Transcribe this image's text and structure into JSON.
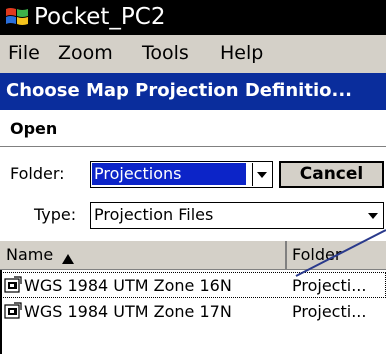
{
  "window": {
    "title": "Pocket_PC2"
  },
  "menu": [
    "File",
    "Zoom",
    "Tools",
    "Help"
  ],
  "dialog": {
    "title": "Choose Map Projection Definitio...",
    "open_label": "Open",
    "folder_label": "Folder:",
    "folder_value": "Projections",
    "cancel_label": "Cancel",
    "type_label": "Type:",
    "type_value": "Projection Files"
  },
  "list": {
    "columns": [
      "Name",
      "Folder"
    ],
    "rows": [
      {
        "name": "WGS 1984 UTM Zone 16N",
        "folder": "Projecti..."
      },
      {
        "name": "WGS 1984 UTM Zone 17N",
        "folder": "Projecti..."
      }
    ]
  },
  "colors": {
    "title_bg": "#000000",
    "dialog_header_bg": "#0a2d9c",
    "selection": "#0c24c8",
    "pointer": "#2a3a8c"
  },
  "icons": [
    "windows-flag-icon",
    "dropdown-arrow-icon",
    "sort-ascending-icon",
    "projection-file-icon"
  ]
}
